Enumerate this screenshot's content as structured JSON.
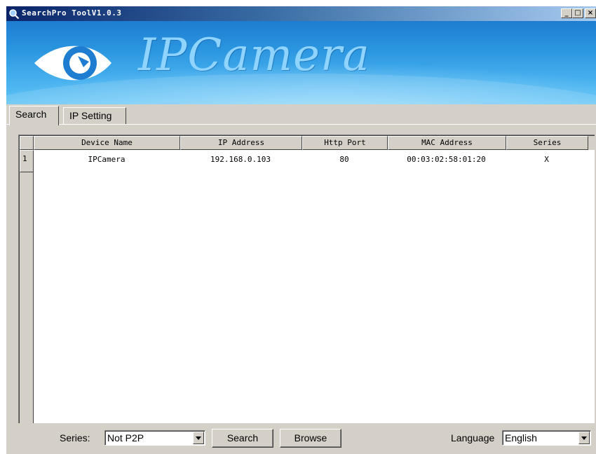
{
  "window": {
    "title": "SearchPro ToolV1.0.3",
    "controls": {
      "minimize": "_",
      "maximize": "□",
      "close": "×"
    }
  },
  "banner": {
    "logo_text": "IPCamera",
    "logo_icon": "eye-logo-icon"
  },
  "tabs": [
    {
      "label": "Search",
      "active": true
    },
    {
      "label": "IP Setting",
      "active": false
    }
  ],
  "table": {
    "columns": [
      "Device Name",
      "IP Address",
      "Http Port",
      "MAC Address",
      "Series"
    ],
    "rows": [
      {
        "index": "1",
        "cells": [
          "IPCamera",
          "192.168.0.103",
          "80",
          "00:03:02:58:01:20",
          "X"
        ]
      }
    ]
  },
  "controls": {
    "series_label": "Series:",
    "series_value": "Not P2P",
    "search_button": "Search",
    "browse_button": "Browse",
    "language_label": "Language",
    "language_value": "English"
  },
  "colors": {
    "window_bg": "#d4d0c8",
    "titlebar_start": "#0a246a",
    "titlebar_end": "#a6caf0",
    "banner": "#2b96e0"
  }
}
